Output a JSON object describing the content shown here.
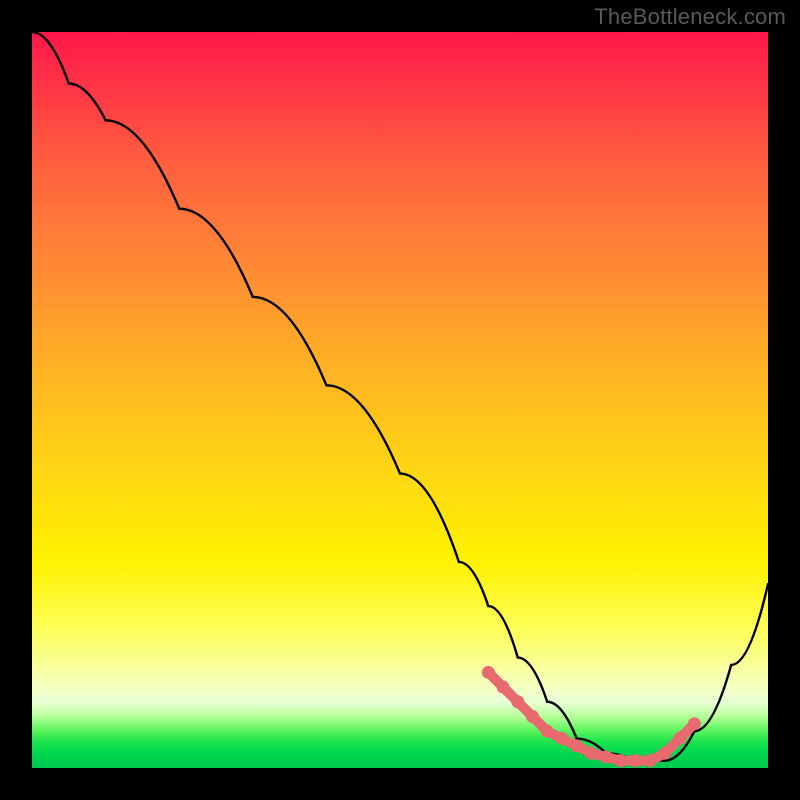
{
  "attribution": "TheBottleneck.com",
  "chart_data": {
    "type": "line",
    "title": "",
    "xlabel": "",
    "ylabel": "",
    "xlim": [
      0,
      100
    ],
    "ylim": [
      0,
      100
    ],
    "curve": {
      "x": [
        0,
        5,
        10,
        20,
        30,
        40,
        50,
        58,
        62,
        66,
        70,
        74,
        78,
        82,
        86,
        90,
        95,
        100
      ],
      "y": [
        100,
        93,
        88,
        76,
        64,
        52,
        40,
        28,
        22,
        15,
        9,
        4,
        2,
        1,
        1,
        5,
        14,
        25
      ]
    },
    "markers": {
      "x": [
        62,
        64,
        66,
        68,
        70,
        72,
        74,
        76,
        78,
        80,
        82,
        84,
        86,
        88,
        90
      ],
      "y": [
        13,
        11,
        9,
        7,
        5,
        4,
        3,
        2,
        1.5,
        1,
        1,
        1,
        2,
        4,
        6
      ]
    },
    "colors": {
      "line": "#000000",
      "marker": "#e86a6f"
    }
  }
}
